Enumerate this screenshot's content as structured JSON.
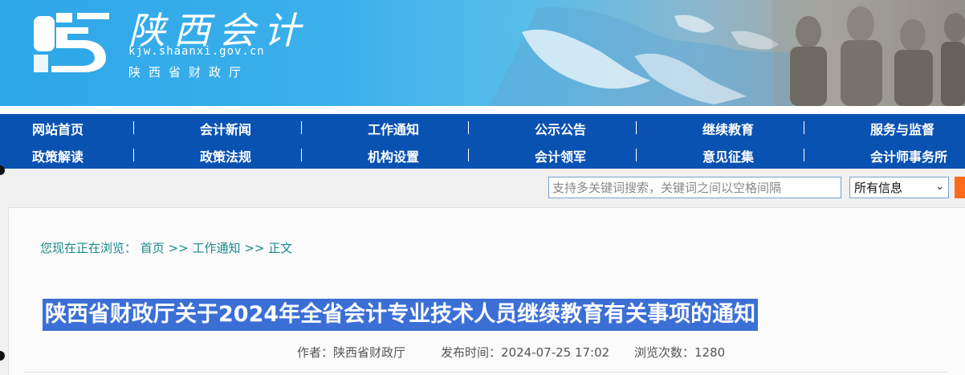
{
  "header": {
    "title": "陕西会计",
    "url": "kjw.shaanxi.gov.cn",
    "org": "陕西省财政厅"
  },
  "nav": {
    "row1": [
      "网站首页",
      "会计新闻",
      "工作通知",
      "公示公告",
      "继续教育",
      "服务与监督"
    ],
    "row2": [
      "政策解读",
      "政策法规",
      "机构设置",
      "会计领军",
      "意见征集",
      "会计师事务所"
    ]
  },
  "search": {
    "placeholder": "支持多关键词搜索，关键词之间以空格间隔",
    "scope_selected": "所有信息"
  },
  "breadcrumb": {
    "prefix": "您现在正在浏览：",
    "items": [
      "首页",
      "工作通知",
      "正文"
    ],
    "separator": ">>"
  },
  "article": {
    "title": "陕西省财政厅关于2024年全省会计专业技术人员继续教育有关事项的通知",
    "author_label": "作者：",
    "author": "陕西省财政厅",
    "published_label": "发布时间：",
    "published": "2024-07-25 17:02",
    "views_label": "浏览次数：",
    "views": "1280"
  },
  "colors": {
    "nav_bg": "#0a52b2",
    "title_highlight": "#3b6fd6",
    "breadcrumb": "#1a8a8a",
    "search_button": "#ff6a1a"
  }
}
